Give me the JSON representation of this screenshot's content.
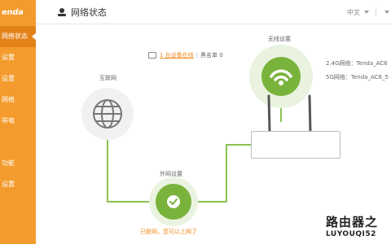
{
  "sidebar": {
    "logo": "enda",
    "items": [
      {
        "label": "网络状态",
        "active": true
      },
      {
        "label": "设置"
      },
      {
        "label": "设置"
      },
      {
        "label": "网络"
      },
      {
        "label": "带电"
      },
      {
        "label": ""
      },
      {
        "label": "功能"
      },
      {
        "label": "设置"
      }
    ]
  },
  "header": {
    "title": "网络状态",
    "language": "中文"
  },
  "diagram": {
    "devices_online": "1 台设备在线",
    "blacklist": "黑名单 0",
    "internet_label": "互联网",
    "wan_label": "外网设置",
    "wan_status": "已联网，您可以上网了",
    "wireless_label": "无线设置",
    "ssid_24g": "2.4G网络：Tenda_AC6",
    "ssid_5g": "5G网络：Tenda_AC6_5"
  },
  "watermark": {
    "cn": "路由器之",
    "en": "LUYOUQI52"
  },
  "colors": {
    "sidebar": "#f39b2c",
    "accent_green": "#7ab33c",
    "link_orange": "#f08a1c"
  },
  "icons": [
    "router-status-icon",
    "globe-icon",
    "wifi-icon",
    "check-icon",
    "monitor-icon",
    "caret-down-icon"
  ]
}
